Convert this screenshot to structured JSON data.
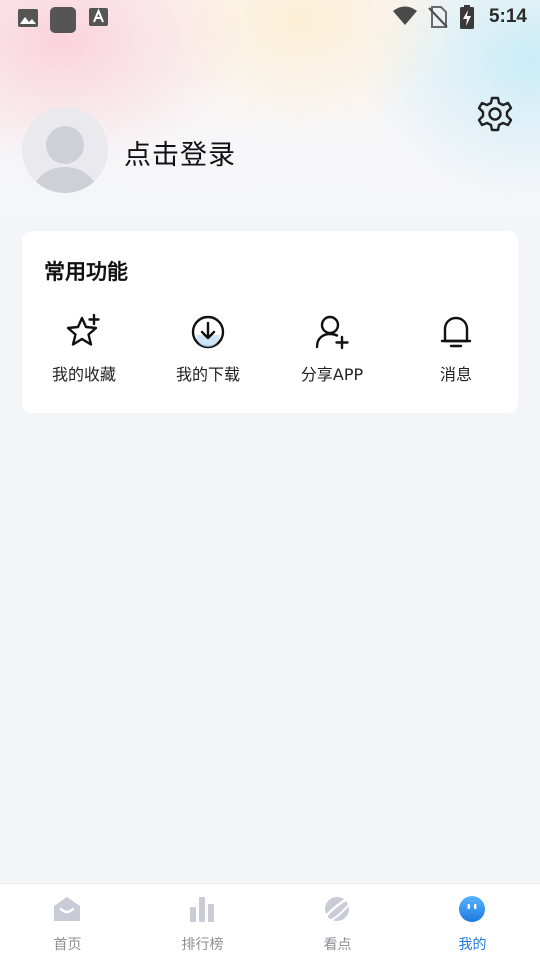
{
  "status_bar": {
    "time": "5:14"
  },
  "profile": {
    "login_text": "点击登录"
  },
  "common_functions": {
    "title": "常用功能",
    "items": [
      {
        "label": "我的收藏",
        "icon": "star-plus-icon"
      },
      {
        "label": "我的下载",
        "icon": "download-icon"
      },
      {
        "label": "分享APP",
        "icon": "add-user-icon"
      },
      {
        "label": "消息",
        "icon": "bell-icon"
      }
    ]
  },
  "bottom_nav": {
    "items": [
      {
        "label": "首页",
        "icon": "home-icon"
      },
      {
        "label": "排行榜",
        "icon": "bar-chart-icon"
      },
      {
        "label": "看点",
        "icon": "planet-icon"
      },
      {
        "label": "我的",
        "icon": "smile-face-icon",
        "active": true
      }
    ]
  },
  "colors": {
    "accent": "#1f7ae0",
    "inactive": "#8e8e96",
    "background": "#f4f5f8"
  }
}
